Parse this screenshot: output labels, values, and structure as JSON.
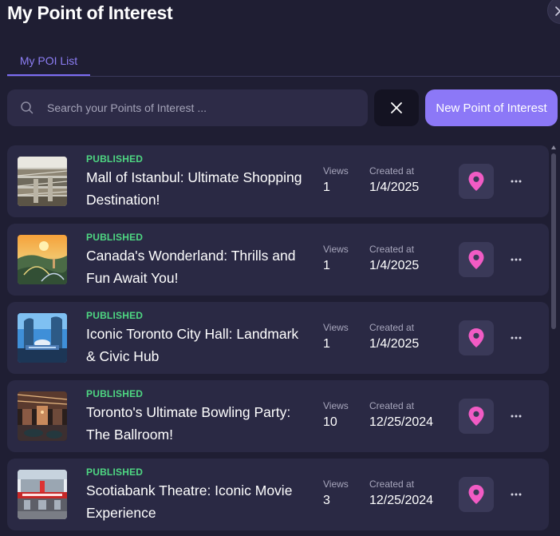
{
  "header": {
    "title": "My Point of Interest"
  },
  "tabs": [
    {
      "label": "My POI List",
      "active": true
    }
  ],
  "search": {
    "placeholder": "Search your Points of Interest ...",
    "value": ""
  },
  "actions": {
    "new_label": "New Point of Interest"
  },
  "columns": {
    "views_label": "Views",
    "created_label": "Created at"
  },
  "pois": [
    {
      "status": "PUBLISHED",
      "title": "Mall of Istanbul: Ultimate Shopping Destination!",
      "views": "1",
      "created": "1/4/2025"
    },
    {
      "status": "PUBLISHED",
      "title": "Canada's Wonderland: Thrills and Fun Await You!",
      "views": "1",
      "created": "1/4/2025"
    },
    {
      "status": "PUBLISHED",
      "title": "Iconic Toronto City Hall: Landmark & Civic Hub",
      "views": "1",
      "created": "1/4/2025"
    },
    {
      "status": "PUBLISHED",
      "title": "Toronto's Ultimate Bowling Party: The Ballroom!",
      "views": "10",
      "created": "12/25/2024"
    },
    {
      "status": "PUBLISHED",
      "title": "Scotiabank Theatre: Iconic Movie Experience",
      "views": "3",
      "created": "12/25/2024"
    }
  ],
  "colors": {
    "background": "#1f1e33",
    "card": "#2a2944",
    "accent": "#8c78f7",
    "published": "#4ed682",
    "pin": "#f15bc4"
  },
  "icons": {
    "search": "search-icon",
    "clear": "close-icon",
    "pin": "map-pin-icon",
    "more": "more-horizontal-icon"
  }
}
